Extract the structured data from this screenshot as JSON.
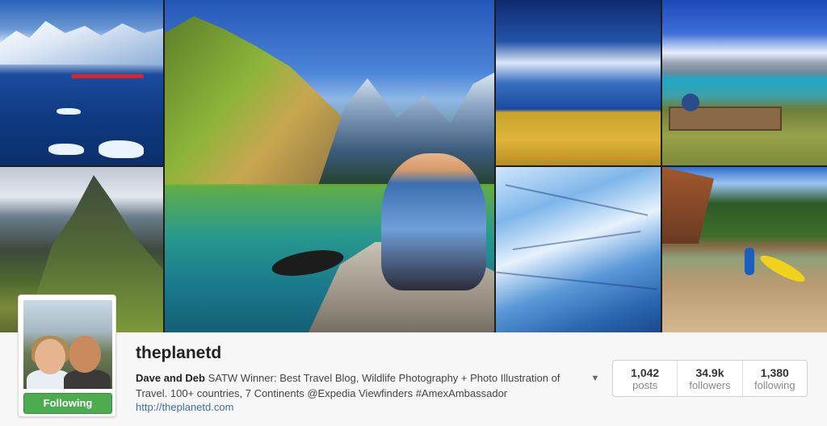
{
  "profile": {
    "username": "theplanetd",
    "display_name": "Dave and Deb",
    "bio": " SATW Winner: Best Travel Blog, Wildlife Photography + Photo Illustration of Travel. 100+ countries, 7 Continents @Expedia Viewfinders #AmexAmbassador",
    "website": "http://theplanetd.com",
    "follow_button_label": "Following",
    "follow_button_color": "#4cac4f",
    "link_color": "#3a6ea5"
  },
  "stats": [
    {
      "value": "1,042",
      "label": "posts"
    },
    {
      "value": "34.9k",
      "label": "followers"
    },
    {
      "value": "1,380",
      "label": "following"
    }
  ],
  "icons": {
    "dropdown": "chevron-down-icon"
  }
}
